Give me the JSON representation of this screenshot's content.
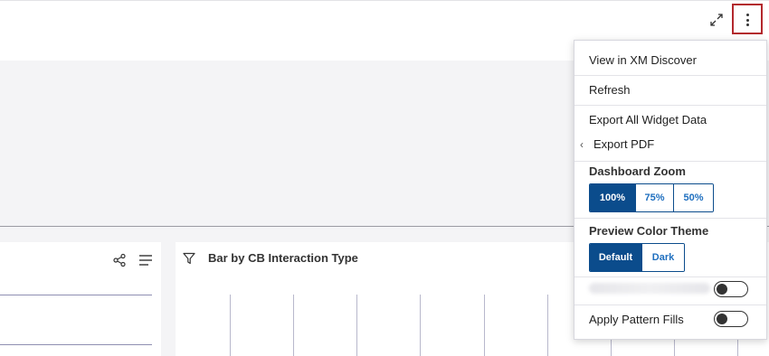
{
  "header": {
    "expand_icon": "expand-arrows-icon",
    "kebab_icon": "vertical-dots-icon"
  },
  "widgets": {
    "left": {
      "icons": [
        "share-icon",
        "menu-lines-icon"
      ]
    },
    "right": {
      "filter_icon": "filter-funnel-icon",
      "title": "Bar by CB Interaction Type"
    }
  },
  "menu": {
    "items": {
      "view": "View in XM Discover",
      "refresh": "Refresh",
      "export_all": "Export All Widget Data",
      "export_pdf": "Export PDF",
      "export_pdf_chevron": "‹"
    },
    "zoom": {
      "heading": "Dashboard Zoom",
      "options": [
        "100%",
        "75%",
        "50%"
      ],
      "selected": "100%"
    },
    "theme": {
      "heading": "Preview Color Theme",
      "options": [
        "Default",
        "Dark"
      ],
      "selected": "Default"
    },
    "toggles": {
      "blurred": {
        "on": false
      },
      "pattern_fills": {
        "label": "Apply Pattern Fills",
        "on": false
      }
    }
  },
  "colors": {
    "accent": "#0b4c8c",
    "highlight_border": "#b3282d",
    "page_background": "#f4f4f6"
  }
}
